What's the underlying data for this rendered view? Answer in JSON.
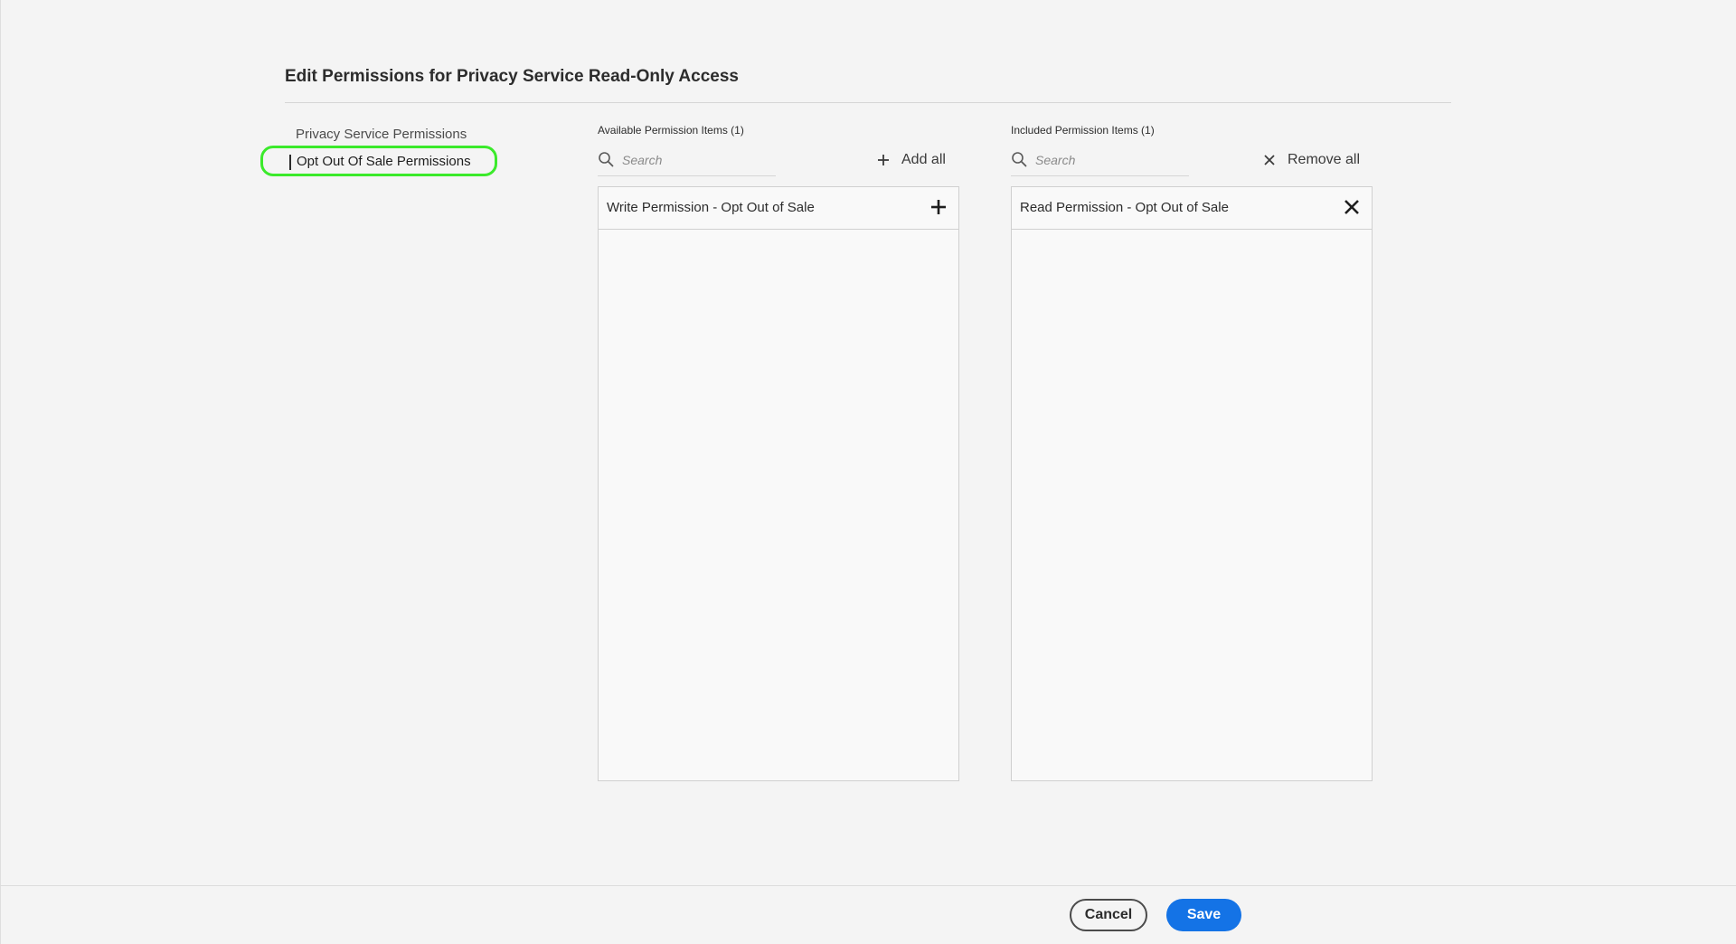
{
  "dialog": {
    "title": "Edit Permissions for Privacy Service Read-Only Access"
  },
  "categories": {
    "heading": "Privacy Service Permissions",
    "items": [
      {
        "label": "Opt Out Of Sale Permissions",
        "selected": true
      }
    ],
    "highlight_color": "#3bea2b"
  },
  "available": {
    "label": "Available Permission Items (1)",
    "search_placeholder": "Search",
    "search_value": "",
    "bulk_action_label": "Add all",
    "items": [
      {
        "label": "Write Permission - Opt Out of Sale",
        "action_icon": "plus-icon"
      }
    ]
  },
  "included": {
    "label": "Included Permission Items (1)",
    "search_placeholder": "Search",
    "search_value": "",
    "bulk_action_label": "Remove all",
    "items": [
      {
        "label": "Read Permission - Opt Out of Sale",
        "action_icon": "close-icon"
      }
    ]
  },
  "footer": {
    "cancel_label": "Cancel",
    "save_label": "Save",
    "primary_color": "#1473e6"
  }
}
